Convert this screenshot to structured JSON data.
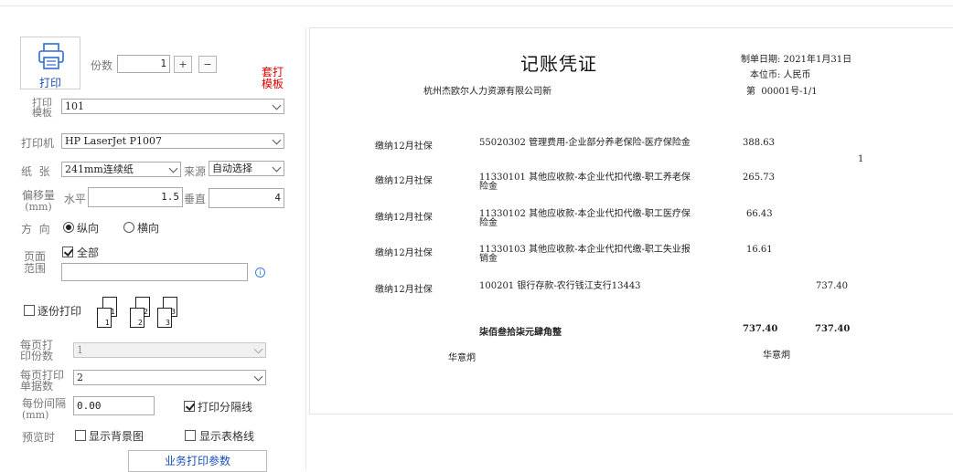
{
  "left": {
    "print_label": "打印",
    "copies_label": "份数",
    "copies_value": "1",
    "plus_label": "+",
    "minus_label": "−",
    "overlay_template_line1": "套打",
    "overlay_template_line2": "模板",
    "template_label_line1": "打印",
    "template_label_line2": "模板",
    "template_value": "101",
    "printer_label": "打印机",
    "printer_value": "HP LaserJet P1007",
    "paper_label": "纸  张",
    "paper_value": "241mm连续纸",
    "source_label": "来源",
    "source_value": "自动选择",
    "offset_label_line1": "偏移量",
    "offset_label_line2": "(mm)",
    "horizontal_label": "水平",
    "horizontal_value": "1.5",
    "vertical_label": "垂直",
    "vertical_value": "4",
    "direction_label": "方  向",
    "portrait_label": "纵向",
    "landscape_label": "横向",
    "range_label_line1": "页面",
    "range_label_line2": "范围",
    "all_label": "全部",
    "range_value": "",
    "collate_label": "逐份打印",
    "collate_pages": [
      "1",
      "2",
      "3"
    ],
    "per_page_copies_label_line1": "每页打",
    "per_page_copies_label_line2": "印份数",
    "per_page_copies_value": "1",
    "per_page_docs_label_line1": "每页打印",
    "per_page_docs_label_line2": "单据数",
    "per_page_docs_value": "2",
    "spacing_label_line1": "每份间隔",
    "spacing_label_line2": "(mm)",
    "spacing_value": "0.00",
    "separator_label": "打印分隔线",
    "preview_label": "预览时",
    "show_bg_label": "显示背景图",
    "show_grid_label": "显示表格线",
    "business_params_label": "业务打印参数"
  },
  "voucher": {
    "title": "记账凭证",
    "company": "杭州杰欧尔人力资源有限公司新",
    "date_text": "制单日期: 2021年1月31日",
    "currency_text": "本位币: 人民币",
    "number_text": "第  00001号-1/1",
    "attachments": "1",
    "rows": [
      {
        "summary": "缴纳12月社保",
        "account": "55020302 管理费用-企业部分养老保险-医疗保险金",
        "debit": "388.63",
        "credit": ""
      },
      {
        "summary": "缴纳12月社保",
        "account": "11330101 其他应收款-本企业代扣代缴-职工养老保险金",
        "debit": "265.73",
        "credit": ""
      },
      {
        "summary": "缴纳12月社保",
        "account": "11330102 其他应收款-本企业代扣代缴-职工医疗保险金",
        "debit": "66.43",
        "credit": ""
      },
      {
        "summary": "缴纳12月社保",
        "account": "11330103 其他应收款-本企业代扣代缴-职工失业报销金",
        "debit": "16.61",
        "credit": ""
      },
      {
        "summary": "缴纳12月社保",
        "account": "100201 银行存款-农行钱江支行13443",
        "debit": "",
        "credit": "737.40"
      }
    ],
    "total_words": "柒佰叁拾柒元肆角整",
    "total_debit": "737.40",
    "total_credit": "737.40",
    "maker_left": "华意炯",
    "maker_right": "华意炯"
  },
  "colors": {
    "link_blue": "#1a4fb8",
    "template_red": "#e00000"
  }
}
